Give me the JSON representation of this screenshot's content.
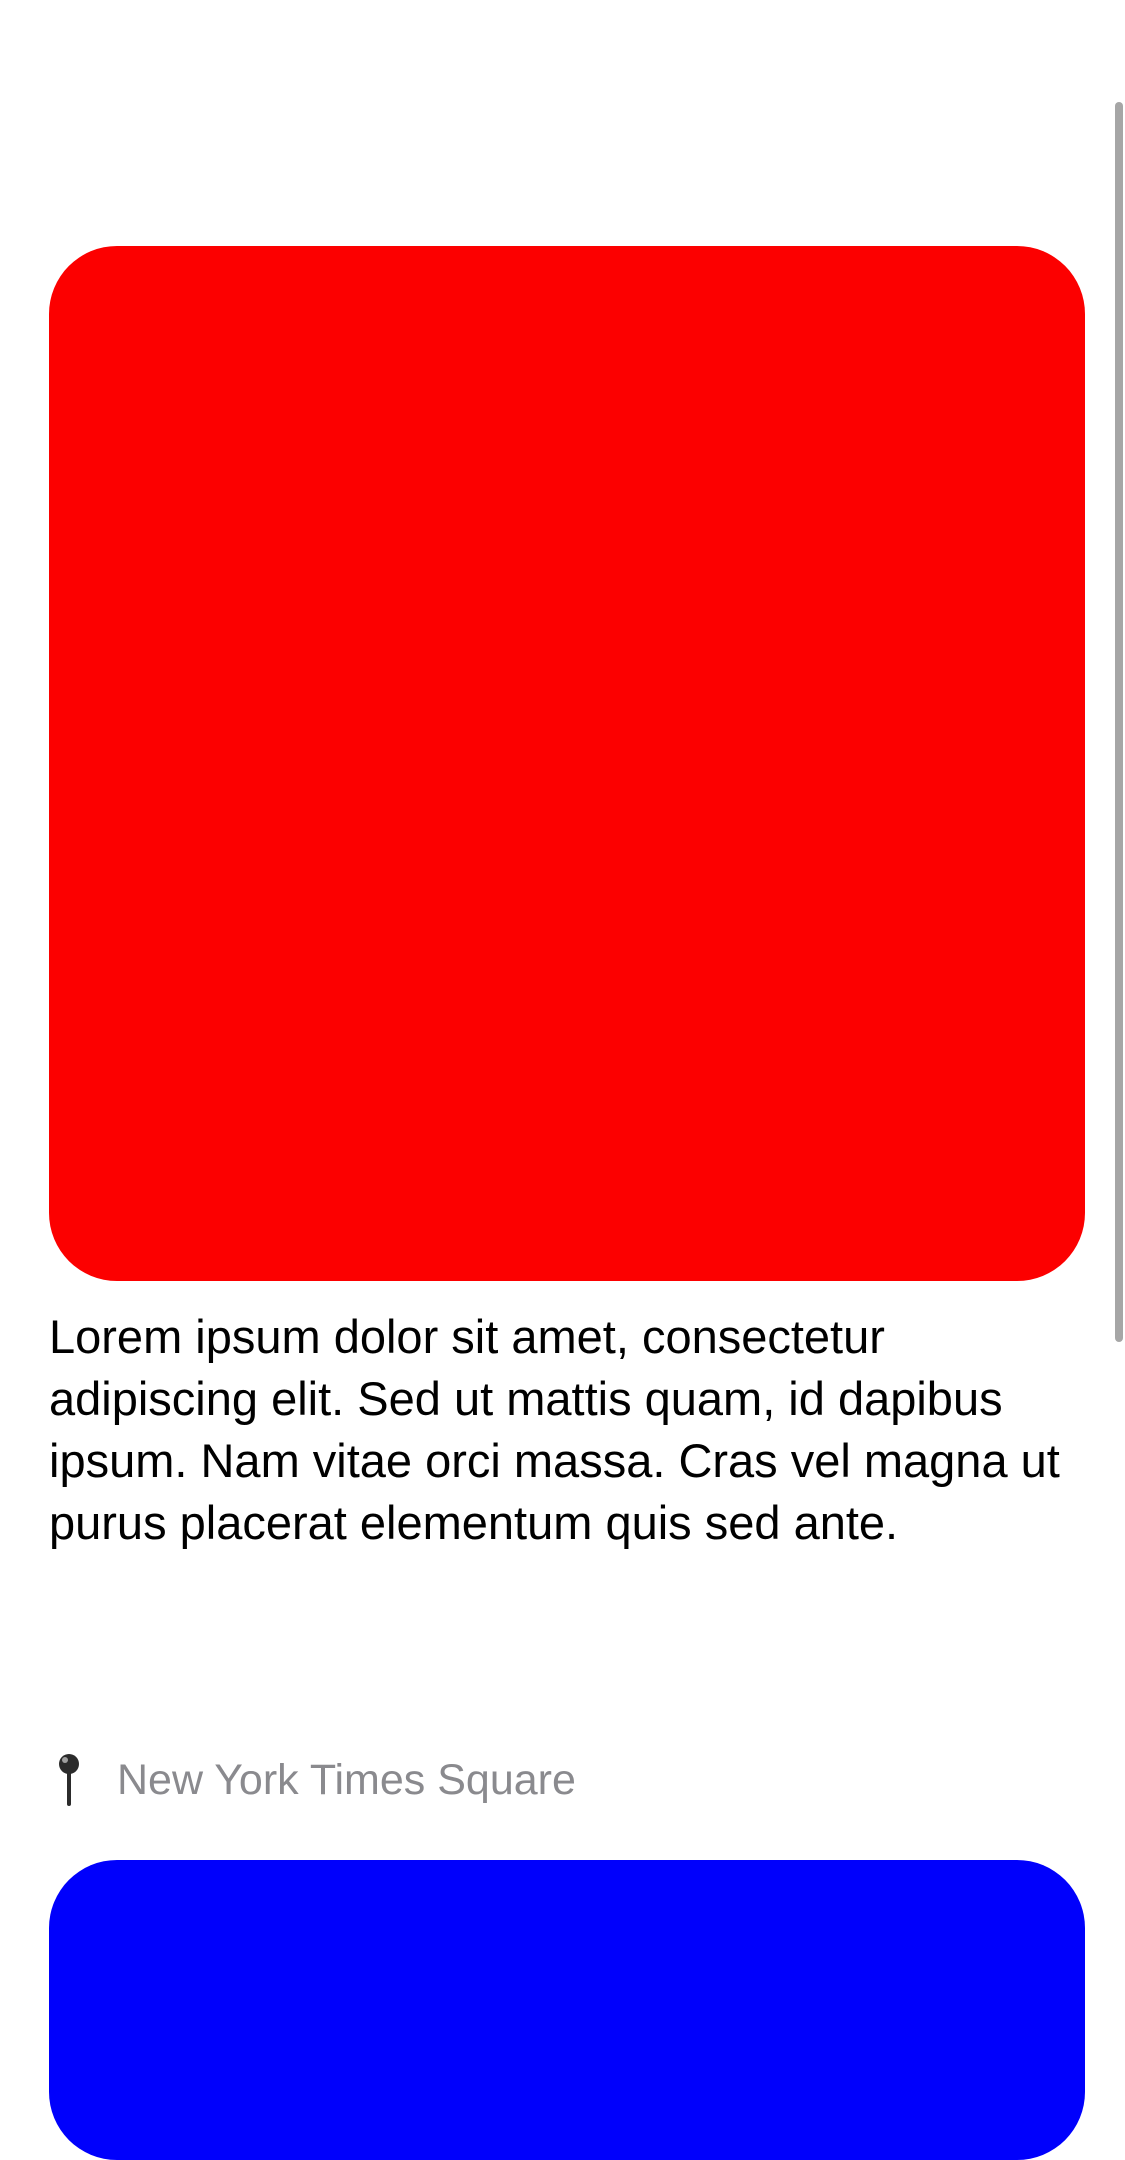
{
  "feed": {
    "post": {
      "image_color": "#fc0000",
      "caption": "Lorem ipsum dolor sit amet, consectetur adipiscing elit. Sed ut mattis quam, id dapibus ipsum. Nam vitae orci massa. Cras vel magna ut purus placerat elementum quis sed ante.",
      "location_icon": "map-pin-icon",
      "location": "New York Times Square"
    },
    "next_post": {
      "image_color": "#0000fc"
    }
  },
  "colors": {
    "caption_text": "#000000",
    "location_text": "#8a8a8e",
    "scrollbar": "#a6a6a6"
  }
}
